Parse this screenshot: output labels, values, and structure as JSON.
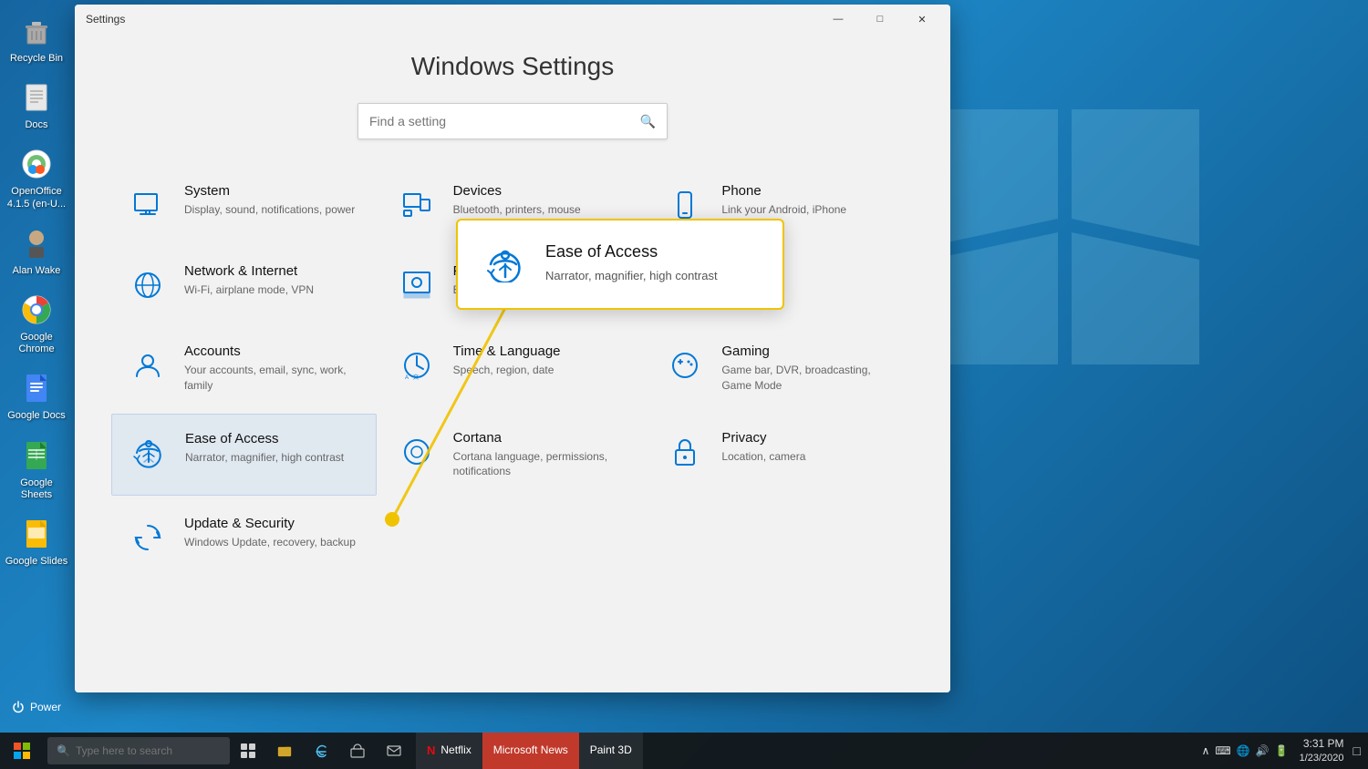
{
  "desktop": {
    "icons": [
      {
        "id": "recycle-bin",
        "label": "Recycle Bin",
        "symbol": "🗑️"
      },
      {
        "id": "docs",
        "label": "Docs",
        "symbol": "📄"
      },
      {
        "id": "openoffice",
        "label": "OpenOffice 4.1.5 (en-U...",
        "symbol": "✍️"
      },
      {
        "id": "alan-wake",
        "label": "Alan Wake",
        "symbol": "👤"
      },
      {
        "id": "google-chrome",
        "label": "Google Chrome",
        "symbol": "🌐"
      },
      {
        "id": "google-docs",
        "label": "Google Docs",
        "symbol": "📝"
      },
      {
        "id": "google-sheets",
        "label": "Google Sheets",
        "symbol": "📊"
      },
      {
        "id": "google-slides",
        "label": "Google Slides",
        "symbol": "📑"
      }
    ],
    "power_label": "Power"
  },
  "window": {
    "title": "Settings",
    "controls": {
      "minimize": "—",
      "maximize": "□",
      "close": "✕"
    }
  },
  "settings": {
    "title": "Windows Settings",
    "search_placeholder": "Find a setting",
    "items": [
      {
        "id": "system",
        "name": "System",
        "desc": "Display, sound, notifications, power"
      },
      {
        "id": "devices",
        "name": "Devices",
        "desc": "Bluetooth, printers, mouse"
      },
      {
        "id": "phone",
        "name": "Phone",
        "desc": "Link your Android, iPhone"
      },
      {
        "id": "network",
        "name": "Network & Internet",
        "desc": "Wi-Fi, airplane mode, VPN"
      },
      {
        "id": "personalization",
        "name": "Personalization",
        "desc": "Background, lock screen, colors"
      },
      {
        "id": "placeholder1",
        "name": "",
        "desc": ""
      },
      {
        "id": "accounts",
        "name": "Accounts",
        "desc": "Your accounts, email, sync, work, family"
      },
      {
        "id": "time-language",
        "name": "Time & Language",
        "desc": "Speech, region, date"
      },
      {
        "id": "gaming",
        "name": "Gaming",
        "desc": "Game bar, DVR, broadcasting, Game Mode"
      },
      {
        "id": "ease-of-access",
        "name": "Ease of Access",
        "desc": "Narrator, magnifier, high contrast"
      },
      {
        "id": "cortana",
        "name": "Cortana",
        "desc": "Cortana language, permissions, notifications"
      },
      {
        "id": "privacy",
        "name": "Privacy",
        "desc": "Location, camera"
      },
      {
        "id": "update-security",
        "name": "Update & Security",
        "desc": "Windows Update, recovery, backup"
      }
    ]
  },
  "tooltip": {
    "title": "Ease of Access",
    "desc": "Narrator, magnifier, high contrast"
  },
  "taskbar": {
    "search_placeholder": "Type here to search",
    "apps": [
      {
        "id": "netflix",
        "label": "Netflix"
      },
      {
        "id": "microsoft-news",
        "label": "Microsoft News"
      },
      {
        "id": "paint-3d",
        "label": "Paint 3D"
      }
    ],
    "time": "3:31 PM",
    "date": "1/23/2020"
  }
}
